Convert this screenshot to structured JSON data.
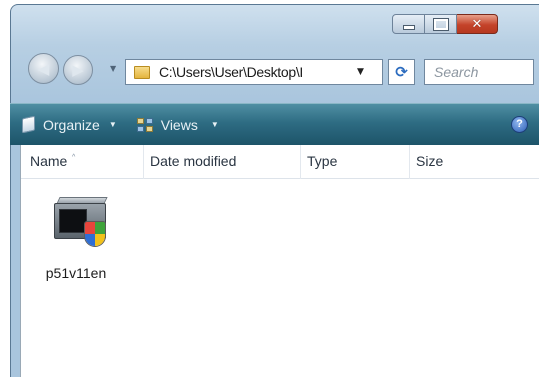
{
  "window": {
    "caption_buttons": {
      "minimize_icon": "minimize-icon",
      "maximize_icon": "maximize-icon",
      "close_icon": "close-icon",
      "close_glyph": "✕",
      "close_color": "#c4432a"
    }
  },
  "navigation": {
    "back_icon": "back-arrow-icon",
    "forward_icon": "forward-arrow-icon",
    "back_glyph": "◀",
    "forward_glyph": "▶",
    "recent_glyph": "▼",
    "address_path": "C:\\Users\\User\\Desktop\\I",
    "address_dropdown_glyph": "▼",
    "refresh_glyph": "⟳",
    "search_placeholder": "Search"
  },
  "toolbar": {
    "background": "#2e6c83",
    "organize_label": "Organize",
    "views_label": "Views",
    "caret_glyph": "▼",
    "help_glyph": "?"
  },
  "file_list": {
    "columns": [
      "Name",
      "Date modified",
      "Type",
      "Size"
    ],
    "sort_glyph": "^",
    "items": [
      {
        "name": "p51v11en",
        "icon": "setup-program-icon"
      }
    ]
  }
}
